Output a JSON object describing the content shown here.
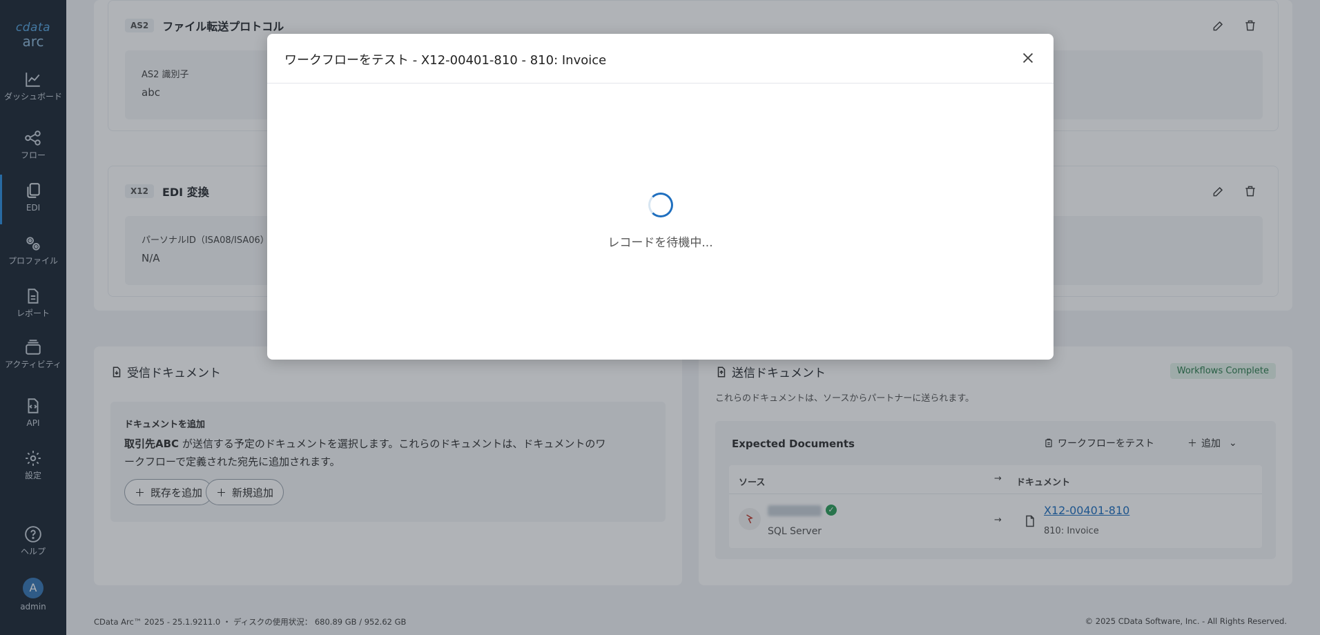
{
  "app": {
    "logo_top": "cdata",
    "logo_bottom": "arc"
  },
  "nav": [
    {
      "label": "ダッシュボード",
      "icon": "chart-line-icon"
    },
    {
      "label": "フロー",
      "icon": "flow-icon"
    },
    {
      "label": "EDI",
      "icon": "copy-icon",
      "active": true
    },
    {
      "label": "プロファイル",
      "icon": "gears-icon"
    },
    {
      "label": "レポート",
      "icon": "document-icon"
    },
    {
      "label": "アクティビティ",
      "icon": "layers-icon"
    },
    {
      "label": "API",
      "icon": "code-file-icon"
    },
    {
      "label": "設定",
      "icon": "gear-icon"
    },
    {
      "label": "ヘルプ",
      "icon": "help-icon"
    }
  ],
  "user": {
    "initial": "A",
    "name": "admin"
  },
  "as2_card": {
    "tag": "AS2",
    "title": "ファイル転送プロトコル",
    "field_label": "AS2 識別子",
    "field_value": "abc"
  },
  "x12_card": {
    "tag": "X12",
    "title": "EDI 変換",
    "field_label": "パーソナルID（ISA08/ISA06）",
    "field_value": "N/A"
  },
  "inbound": {
    "title": "受信ドキュメント",
    "add_heading": "ドキュメントを追加",
    "partner": "取引先ABC",
    "description_1": " が送信する予定のドキュメントを選択します。これらのドキュメントは、ドキュメントのワ",
    "description_2": "ークフローで定義された宛先に追加されます。",
    "add_existing": "既存を追加",
    "add_new": "新規追加"
  },
  "outbound": {
    "title": "送信ドキュメント",
    "badge": "Workflows Complete",
    "subtitle": "これらのドキュメントは、ソースからパートナーに送られます。",
    "expected_title": "Expected Documents",
    "test_workflow": "ワークフローをテスト",
    "add": "追加",
    "col_source": "ソース",
    "col_document": "ドキュメント",
    "row": {
      "source_type": "SQL Server",
      "doc_link": "X12-00401-810",
      "doc_type": "810: Invoice"
    }
  },
  "footer": {
    "left": "CData Arc™ 2025 - 25.1.9211.0 ・ ディスクの使用状況： 680.89 GB / 952.62 GB",
    "right": "© 2025 CData Software, Inc. - All Rights Reserved."
  },
  "modal": {
    "title": "ワークフローをテスト - X12-00401-810 - 810: Invoice",
    "waiting": "レコードを待機中..."
  }
}
